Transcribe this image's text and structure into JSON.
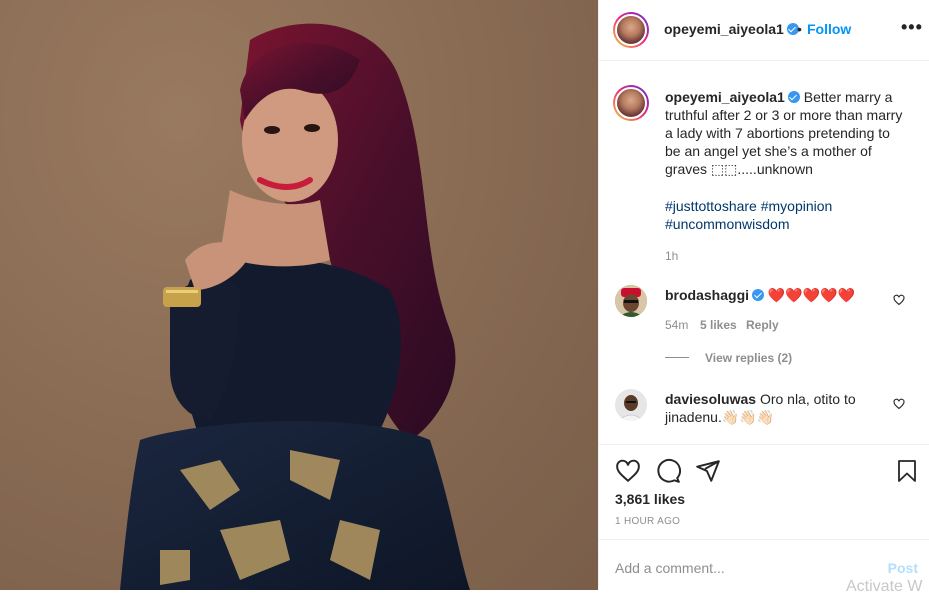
{
  "post": {
    "username": "opeyemi_aiyeola1",
    "follow_label": "Follow",
    "separator": "•",
    "more_label": "•••"
  },
  "caption": {
    "username": "opeyemi_aiyeola1",
    "text": "Better marry a truthful after 2 or 3 or more than marry a lady with 7 abortions pretending to be an angel yet she’s a mother of graves 🤷‍♀️.....unknown",
    "text_display": "Better marry a truthful after 2 or 3 or more than marry a lady with 7 abortions pretending to be an angel yet she’s a mother of graves ⬚⬚.....unknown",
    "hashtags": "#justtottoshare #myopinion #uncommonwisdom",
    "time": "1h"
  },
  "comments": [
    {
      "username": "brodashaggi",
      "text": "❤️❤️❤️❤️❤️",
      "time": "54m",
      "likes": "5 likes",
      "reply": "Reply",
      "view_replies": "View replies (2)"
    },
    {
      "username": "daviesoluwas",
      "text": "Oro nla, otito to jinadenu.👋🏻👋🏻👋🏻"
    }
  ],
  "likes_count": "3,861 likes",
  "posted_ago": "1 HOUR AGO",
  "add_comment": {
    "placeholder": "Add a comment...",
    "post_label": "Post"
  },
  "watermark": "Activate W",
  "colors": {
    "link_blue": "#0095f6",
    "verified_blue": "#3897f0",
    "hashtag": "#00376b",
    "heart_red": "#d00000",
    "muted": "#8e8e8e"
  },
  "icons": [
    "heart-icon",
    "comment-icon",
    "share-icon",
    "bookmark-icon",
    "more-options-icon",
    "verified-icon"
  ]
}
